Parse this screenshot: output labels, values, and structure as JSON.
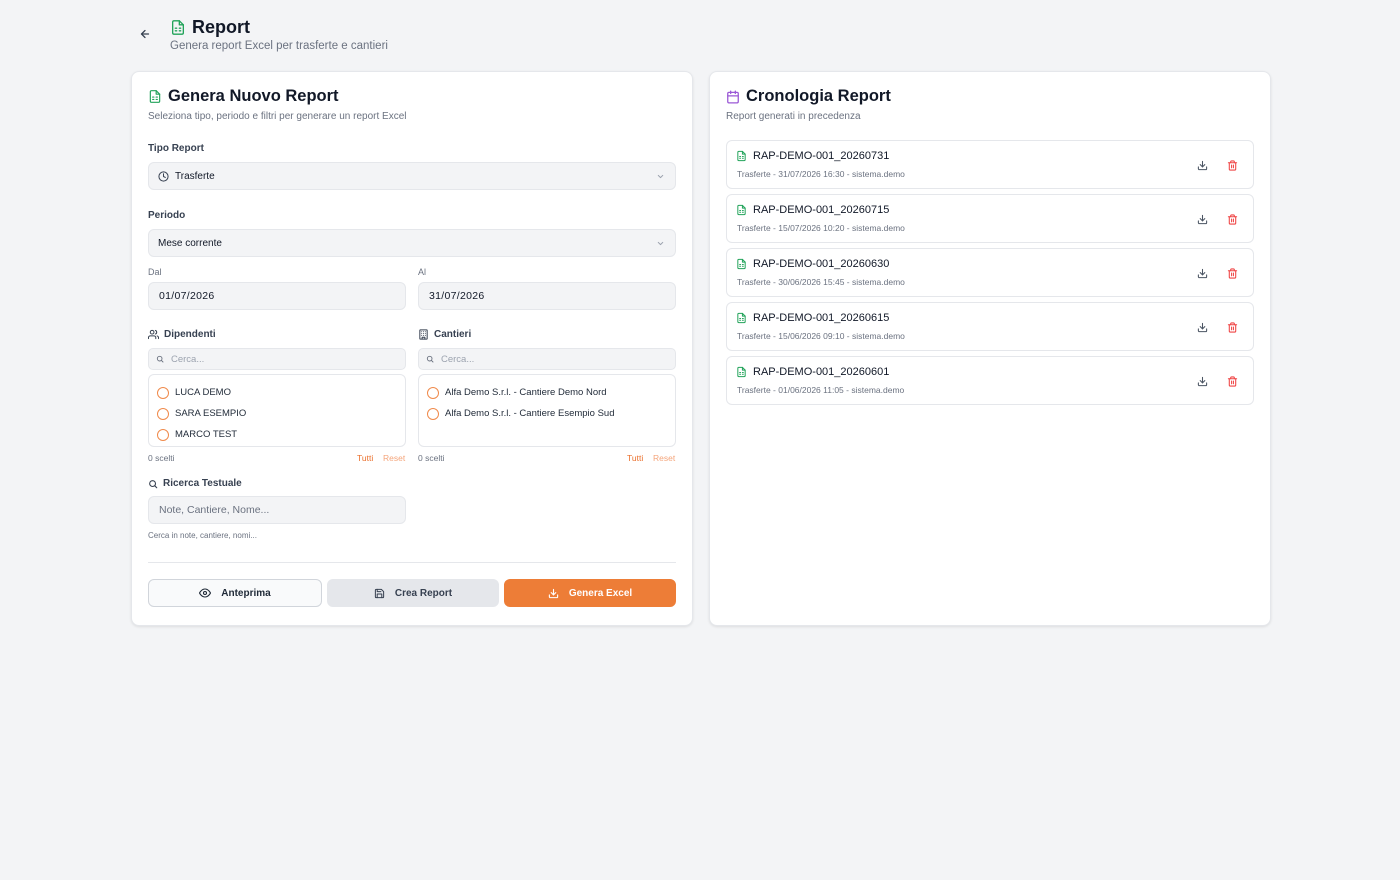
{
  "header": {
    "title": "Report",
    "subtitle": "Genera report Excel per trasferte e cantieri"
  },
  "generate": {
    "title": "Genera Nuovo Report",
    "subtitle": "Seleziona tipo, periodo e filtri per generare un report Excel",
    "tipo_label": "Tipo Report",
    "tipo_value": "Trasferte",
    "periodo_label": "Periodo",
    "periodo_value": "Mese corrente",
    "dal_label": "Dal",
    "dal_value": "01/07/2026",
    "al_label": "Al",
    "al_value": "31/07/2026",
    "dipendenti": {
      "label": "Dipendenti",
      "search_placeholder": "Cerca...",
      "items": [
        "LUCA DEMO",
        "SARA ESEMPIO",
        "MARCO TEST"
      ],
      "count": "0 scelti",
      "all_label": "Tutti",
      "reset_label": "Reset"
    },
    "cantieri": {
      "label": "Cantieri",
      "search_placeholder": "Cerca...",
      "items": [
        "Alfa Demo S.r.l. - Cantiere Demo Nord",
        "Alfa Demo S.r.l. - Cantiere Esempio Sud"
      ],
      "count": "0 scelti",
      "all_label": "Tutti",
      "reset_label": "Reset"
    },
    "ricerca": {
      "label": "Ricerca Testuale",
      "placeholder": "Note, Cantiere, Nome...",
      "hint": "Cerca in note, cantiere, nomi..."
    },
    "buttons": {
      "preview": "Anteprima",
      "create": "Crea Report",
      "excel": "Genera Excel"
    }
  },
  "history": {
    "title": "Cronologia Report",
    "subtitle": "Report generati in precedenza",
    "items": [
      {
        "name": "RAP-DEMO-001_20260731",
        "meta": "Trasferte - 31/07/2026 16:30 - sistema.demo"
      },
      {
        "name": "RAP-DEMO-001_20260715",
        "meta": "Trasferte - 15/07/2026 10:20 - sistema.demo"
      },
      {
        "name": "RAP-DEMO-001_20260630",
        "meta": "Trasferte - 30/06/2026 15:45 - sistema.demo"
      },
      {
        "name": "RAP-DEMO-001_20260615",
        "meta": "Trasferte - 15/06/2026 09:10 - sistema.demo"
      },
      {
        "name": "RAP-DEMO-001_20260601",
        "meta": "Trasferte - 01/06/2026 11:05 - sistema.demo"
      }
    ]
  },
  "colors": {
    "accent": "#ed7d37",
    "file_icon": "#22a35a",
    "calendar_icon": "#9b59d6",
    "delete_icon": "#ef4444",
    "background": "#f3f4f6"
  },
  "icons": {
    "back": "arrow-left-icon",
    "report": "file-spreadsheet-icon",
    "history": "calendar-icon",
    "tipo": "clock-icon",
    "dropdown": "chevron-down-icon",
    "dipendenti": "users-icon",
    "cantieri": "building-icon",
    "search": "search-icon",
    "preview": "eye-icon",
    "create": "save-icon",
    "excel": "download-icon",
    "delete": "trash-icon"
  }
}
